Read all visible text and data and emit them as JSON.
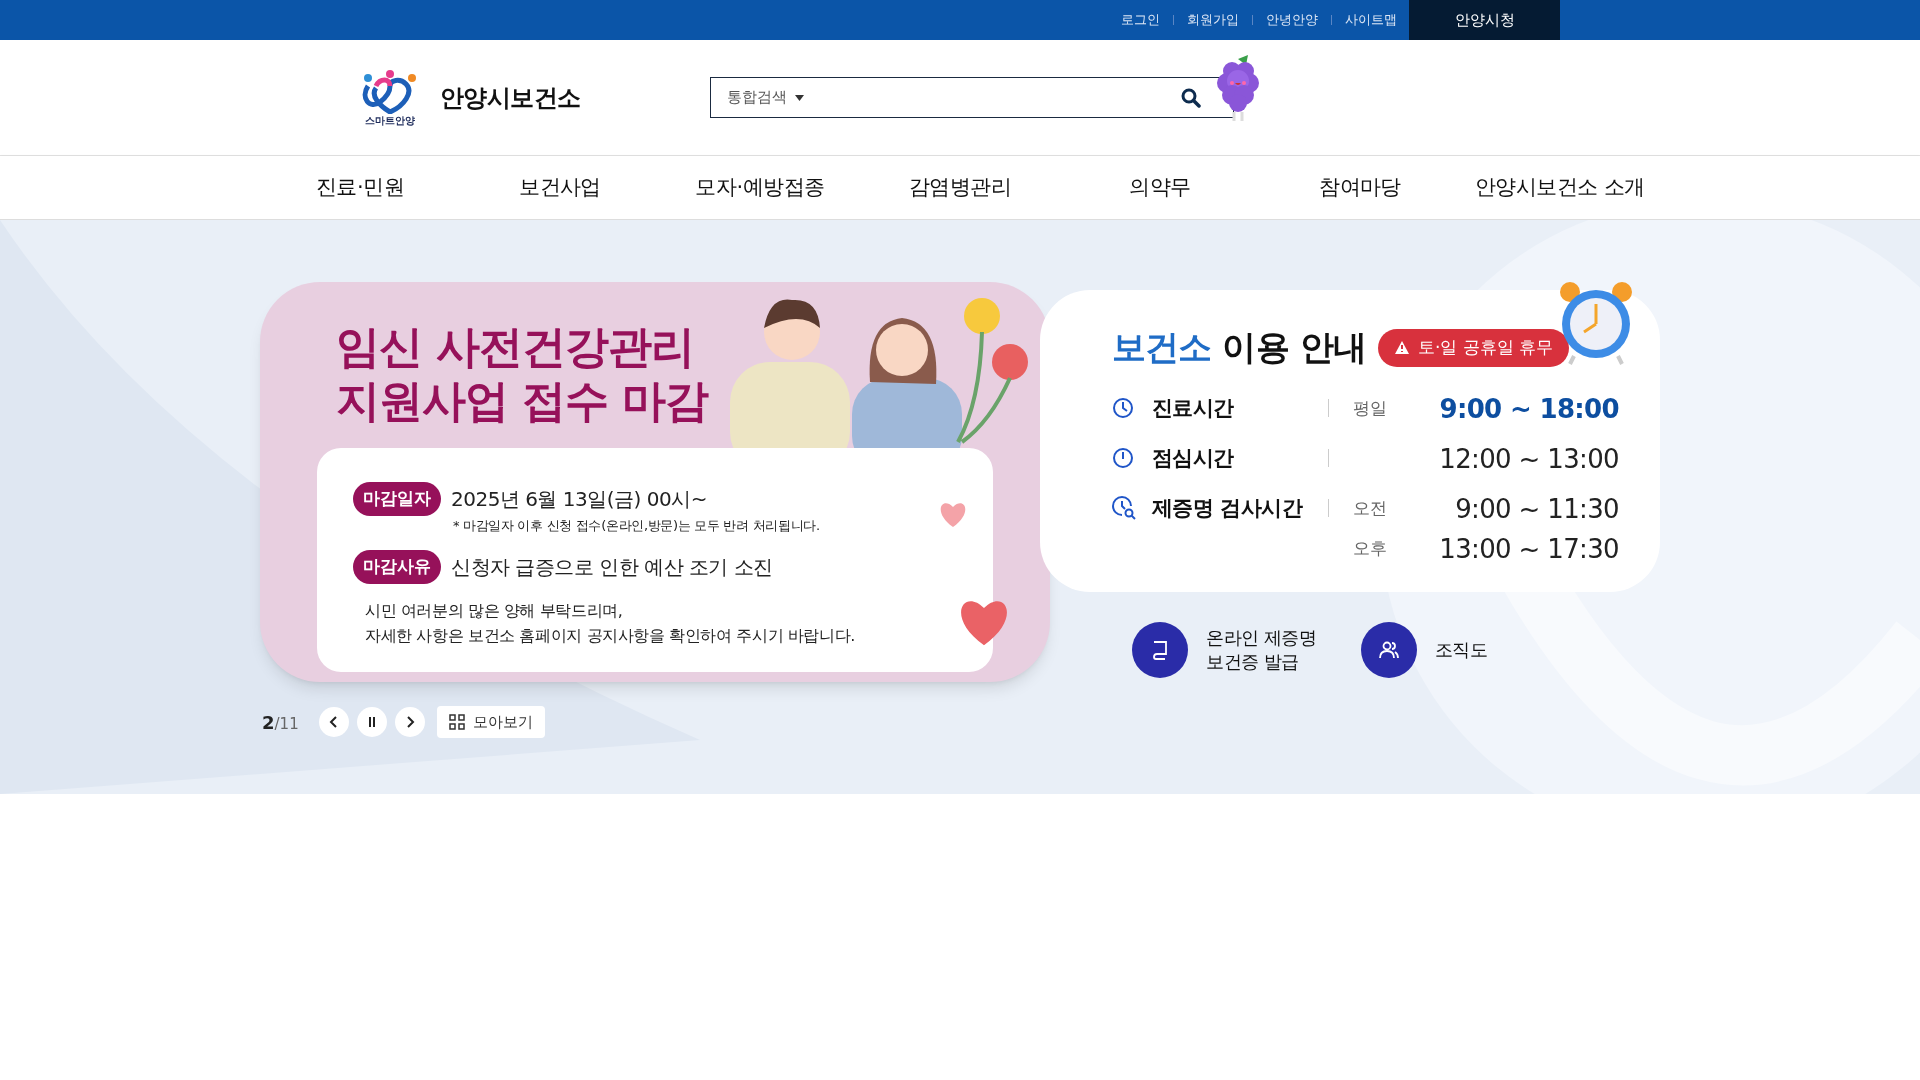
{
  "top_bar": {
    "links": [
      "로그인",
      "회원가입",
      "안녕안양",
      "사이트맵"
    ],
    "city_button": "안양시청"
  },
  "header": {
    "logo_caption": "스마트안양",
    "site_title": "안양시보건소",
    "search": {
      "category": "통합검색"
    }
  },
  "nav": {
    "items": [
      "진료·민원",
      "보건사업",
      "모자·예방접종",
      "감염병관리",
      "의약무",
      "참여마당",
      "안양시보건소 소개"
    ]
  },
  "banner": {
    "title_lines": [
      "임신 사전건강관리",
      "지원사업 접수 마감"
    ],
    "rows": [
      {
        "tag": "마감일자",
        "text": "2025년 6월 13일(금) 00시~",
        "note": "* 마감일자 이후 신청 접수(온라인,방문)는 모두 반려 처리됩니다."
      },
      {
        "tag": "마감사유",
        "text": "신청자 급증으로 인한 예산 조기 소진"
      }
    ],
    "message_lines": [
      "시민 여러분의 많은 양해 부탁드리며,",
      "자세한 사항은 보건소 홈페이지 공지사항을 확인하여 주시기 바랍니다."
    ]
  },
  "slider": {
    "current": "2",
    "total": "/11",
    "gallery_button": "모아보기"
  },
  "info": {
    "title_highlight": "보건소",
    "title_rest": "이용 안내",
    "notice": "토·일 공휴일 휴무",
    "rows": [
      {
        "label": "진료시간",
        "times": [
          {
            "period": "평일",
            "range": "9:00 ~ 18:00",
            "highlight": true
          }
        ]
      },
      {
        "label": "점심시간",
        "times": [
          {
            "range": "12:00 ~ 13:00",
            "highlight": false
          }
        ]
      },
      {
        "label": "제증명 검사시간",
        "times": [
          {
            "period": "오전",
            "range": "9:00 ~ 11:30",
            "highlight": false
          },
          {
            "period": "오후",
            "range": "13:00 ~ 17:30",
            "highlight": false
          }
        ]
      }
    ]
  },
  "quick_links": [
    {
      "lines": [
        "온라인 제증명",
        "보건증 발급"
      ]
    },
    {
      "lines": [
        "조직도"
      ]
    }
  ]
}
